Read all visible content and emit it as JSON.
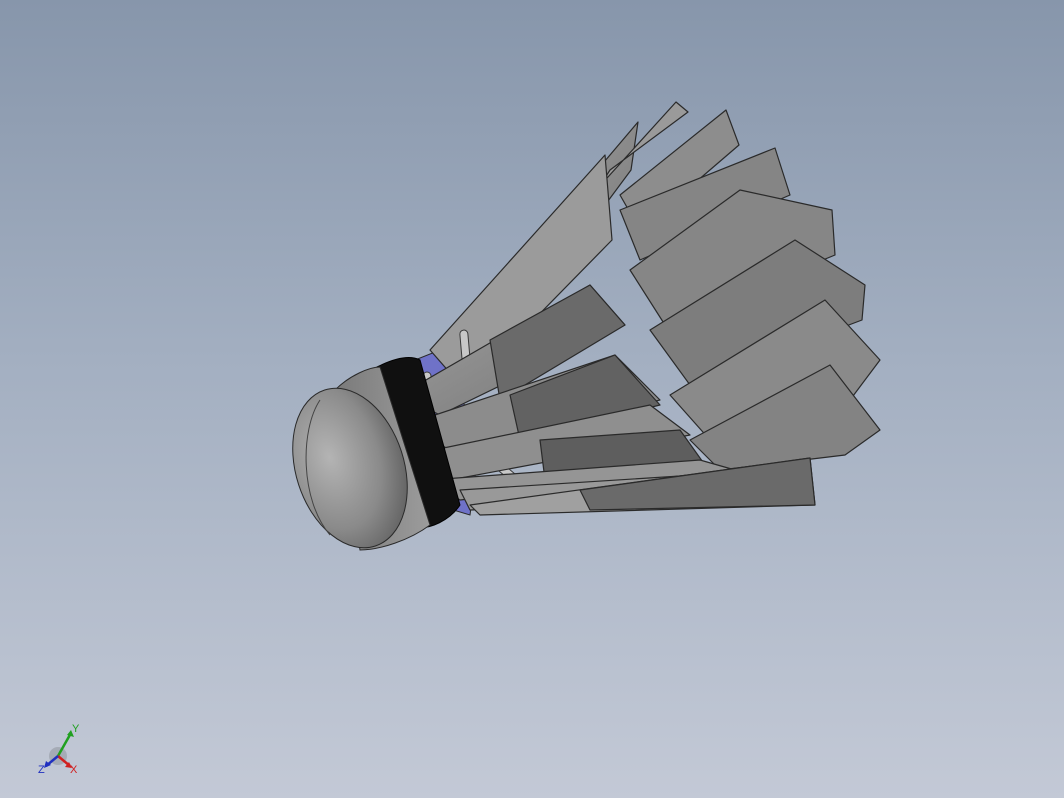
{
  "viewport": {
    "background_top": "#8796ab",
    "background_bottom": "#c3c9d6"
  },
  "model": {
    "feather_color": "#8f8f8f",
    "feather_edge_color": "#2a2a2a",
    "cork_color": "#8a8a8a",
    "band_color": "#111111",
    "inner_color": "#6f72c8",
    "feather_count": 16
  },
  "triad": {
    "x_label": "X",
    "y_label": "Y",
    "z_label": "Z",
    "x_color": "#d02020",
    "y_color": "#20a020",
    "z_color": "#2030c0",
    "icon": "coordinate-triad-icon"
  }
}
